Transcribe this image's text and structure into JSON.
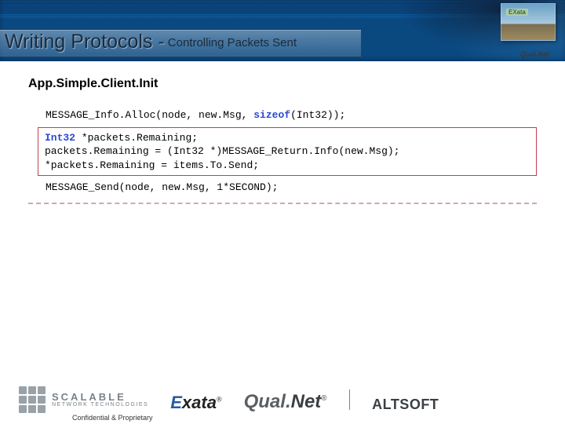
{
  "header": {
    "title_main": "Writing Protocols - ",
    "title_sub": "Controlling Packets Sent",
    "thumb_label": "EXata",
    "thumb_brand": "Qual.Net"
  },
  "section": {
    "heading": "App.Simple.Client.Init"
  },
  "code": {
    "line1_pre": "MESSAGE_Info.Alloc(node, new.Msg, ",
    "line1_kw": "sizeof",
    "line1_post": "(Int32));",
    "box_line1_type": "Int32",
    "box_line1_rest": " *packets.Remaining;",
    "box_line2": "packets.Remaining = (Int32 *)MESSAGE_Return.Info(new.Msg);",
    "box_line3": "*packets.Remaining = items.To.Send;",
    "line4": "MESSAGE_Send(node, new.Msg, 1*SECOND);"
  },
  "footer": {
    "scalable_l1": "SCALABLE",
    "scalable_l2": "NETWORK TECHNOLOGIES",
    "exata_1": "E",
    "exata_2": "xata",
    "qualnet_1": "Qual.",
    "qualnet_2": "Net",
    "reg": "®",
    "altsoft": "ALTSOFT",
    "confidential": "Confidential & Proprietary"
  }
}
